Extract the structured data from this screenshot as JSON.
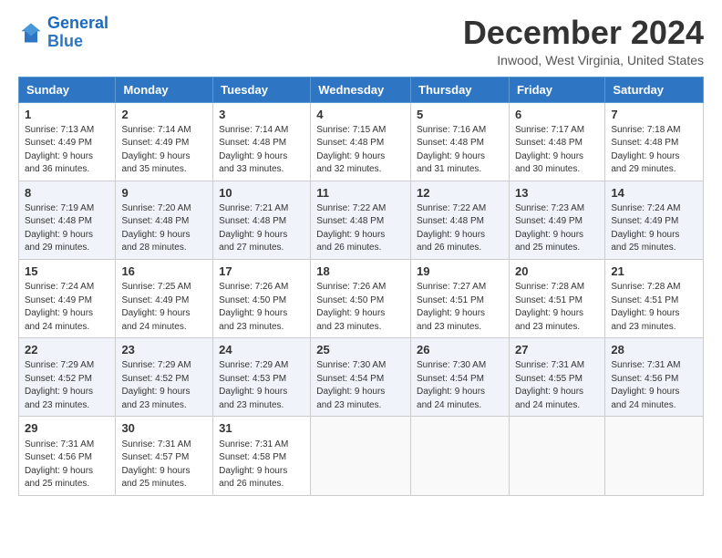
{
  "header": {
    "logo_line1": "General",
    "logo_line2": "Blue",
    "month": "December 2024",
    "location": "Inwood, West Virginia, United States"
  },
  "days_of_week": [
    "Sunday",
    "Monday",
    "Tuesday",
    "Wednesday",
    "Thursday",
    "Friday",
    "Saturday"
  ],
  "weeks": [
    [
      {
        "day": "1",
        "lines": [
          "Sunrise: 7:13 AM",
          "Sunset: 4:49 PM",
          "Daylight: 9 hours",
          "and 36 minutes."
        ]
      },
      {
        "day": "2",
        "lines": [
          "Sunrise: 7:14 AM",
          "Sunset: 4:49 PM",
          "Daylight: 9 hours",
          "and 35 minutes."
        ]
      },
      {
        "day": "3",
        "lines": [
          "Sunrise: 7:14 AM",
          "Sunset: 4:48 PM",
          "Daylight: 9 hours",
          "and 33 minutes."
        ]
      },
      {
        "day": "4",
        "lines": [
          "Sunrise: 7:15 AM",
          "Sunset: 4:48 PM",
          "Daylight: 9 hours",
          "and 32 minutes."
        ]
      },
      {
        "day": "5",
        "lines": [
          "Sunrise: 7:16 AM",
          "Sunset: 4:48 PM",
          "Daylight: 9 hours",
          "and 31 minutes."
        ]
      },
      {
        "day": "6",
        "lines": [
          "Sunrise: 7:17 AM",
          "Sunset: 4:48 PM",
          "Daylight: 9 hours",
          "and 30 minutes."
        ]
      },
      {
        "day": "7",
        "lines": [
          "Sunrise: 7:18 AM",
          "Sunset: 4:48 PM",
          "Daylight: 9 hours",
          "and 29 minutes."
        ]
      }
    ],
    [
      {
        "day": "8",
        "lines": [
          "Sunrise: 7:19 AM",
          "Sunset: 4:48 PM",
          "Daylight: 9 hours",
          "and 29 minutes."
        ]
      },
      {
        "day": "9",
        "lines": [
          "Sunrise: 7:20 AM",
          "Sunset: 4:48 PM",
          "Daylight: 9 hours",
          "and 28 minutes."
        ]
      },
      {
        "day": "10",
        "lines": [
          "Sunrise: 7:21 AM",
          "Sunset: 4:48 PM",
          "Daylight: 9 hours",
          "and 27 minutes."
        ]
      },
      {
        "day": "11",
        "lines": [
          "Sunrise: 7:22 AM",
          "Sunset: 4:48 PM",
          "Daylight: 9 hours",
          "and 26 minutes."
        ]
      },
      {
        "day": "12",
        "lines": [
          "Sunrise: 7:22 AM",
          "Sunset: 4:48 PM",
          "Daylight: 9 hours",
          "and 26 minutes."
        ]
      },
      {
        "day": "13",
        "lines": [
          "Sunrise: 7:23 AM",
          "Sunset: 4:49 PM",
          "Daylight: 9 hours",
          "and 25 minutes."
        ]
      },
      {
        "day": "14",
        "lines": [
          "Sunrise: 7:24 AM",
          "Sunset: 4:49 PM",
          "Daylight: 9 hours",
          "and 25 minutes."
        ]
      }
    ],
    [
      {
        "day": "15",
        "lines": [
          "Sunrise: 7:24 AM",
          "Sunset: 4:49 PM",
          "Daylight: 9 hours",
          "and 24 minutes."
        ]
      },
      {
        "day": "16",
        "lines": [
          "Sunrise: 7:25 AM",
          "Sunset: 4:49 PM",
          "Daylight: 9 hours",
          "and 24 minutes."
        ]
      },
      {
        "day": "17",
        "lines": [
          "Sunrise: 7:26 AM",
          "Sunset: 4:50 PM",
          "Daylight: 9 hours",
          "and 23 minutes."
        ]
      },
      {
        "day": "18",
        "lines": [
          "Sunrise: 7:26 AM",
          "Sunset: 4:50 PM",
          "Daylight: 9 hours",
          "and 23 minutes."
        ]
      },
      {
        "day": "19",
        "lines": [
          "Sunrise: 7:27 AM",
          "Sunset: 4:51 PM",
          "Daylight: 9 hours",
          "and 23 minutes."
        ]
      },
      {
        "day": "20",
        "lines": [
          "Sunrise: 7:28 AM",
          "Sunset: 4:51 PM",
          "Daylight: 9 hours",
          "and 23 minutes."
        ]
      },
      {
        "day": "21",
        "lines": [
          "Sunrise: 7:28 AM",
          "Sunset: 4:51 PM",
          "Daylight: 9 hours",
          "and 23 minutes."
        ]
      }
    ],
    [
      {
        "day": "22",
        "lines": [
          "Sunrise: 7:29 AM",
          "Sunset: 4:52 PM",
          "Daylight: 9 hours",
          "and 23 minutes."
        ]
      },
      {
        "day": "23",
        "lines": [
          "Sunrise: 7:29 AM",
          "Sunset: 4:52 PM",
          "Daylight: 9 hours",
          "and 23 minutes."
        ]
      },
      {
        "day": "24",
        "lines": [
          "Sunrise: 7:29 AM",
          "Sunset: 4:53 PM",
          "Daylight: 9 hours",
          "and 23 minutes."
        ]
      },
      {
        "day": "25",
        "lines": [
          "Sunrise: 7:30 AM",
          "Sunset: 4:54 PM",
          "Daylight: 9 hours",
          "and 23 minutes."
        ]
      },
      {
        "day": "26",
        "lines": [
          "Sunrise: 7:30 AM",
          "Sunset: 4:54 PM",
          "Daylight: 9 hours",
          "and 24 minutes."
        ]
      },
      {
        "day": "27",
        "lines": [
          "Sunrise: 7:31 AM",
          "Sunset: 4:55 PM",
          "Daylight: 9 hours",
          "and 24 minutes."
        ]
      },
      {
        "day": "28",
        "lines": [
          "Sunrise: 7:31 AM",
          "Sunset: 4:56 PM",
          "Daylight: 9 hours",
          "and 24 minutes."
        ]
      }
    ],
    [
      {
        "day": "29",
        "lines": [
          "Sunrise: 7:31 AM",
          "Sunset: 4:56 PM",
          "Daylight: 9 hours",
          "and 25 minutes."
        ]
      },
      {
        "day": "30",
        "lines": [
          "Sunrise: 7:31 AM",
          "Sunset: 4:57 PM",
          "Daylight: 9 hours",
          "and 25 minutes."
        ]
      },
      {
        "day": "31",
        "lines": [
          "Sunrise: 7:31 AM",
          "Sunset: 4:58 PM",
          "Daylight: 9 hours",
          "and 26 minutes."
        ]
      },
      null,
      null,
      null,
      null
    ]
  ]
}
